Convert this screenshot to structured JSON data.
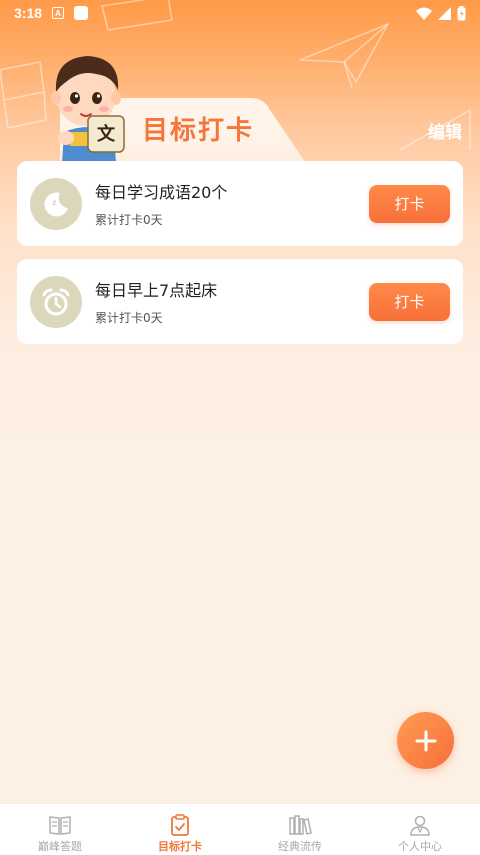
{
  "status_bar": {
    "time": "3:18",
    "app_badge": "A"
  },
  "header": {
    "title": "目标打卡",
    "edit_label": "编辑",
    "mascot_badge": "文"
  },
  "goals": [
    {
      "title": "每日学习成语20个",
      "count_text": "累计打卡0天",
      "button_label": "打卡",
      "icon": "moon-sleep-icon"
    },
    {
      "title": "每日早上7点起床",
      "count_text": "累计打卡0天",
      "button_label": "打卡",
      "icon": "alarm-clock-icon"
    }
  ],
  "fab": {
    "icon": "plus-icon"
  },
  "bottom_nav": {
    "active_index": 1,
    "items": [
      {
        "label": "巅峰答题",
        "icon": "open-book-icon"
      },
      {
        "label": "目标打卡",
        "icon": "checklist-icon"
      },
      {
        "label": "经典流传",
        "icon": "bookshelf-icon"
      },
      {
        "label": "个人中心",
        "icon": "person-icon"
      }
    ]
  },
  "colors": {
    "accent": "#f4763a",
    "icon_bg": "#dbd7bb",
    "inactive": "#a8a8a8"
  }
}
